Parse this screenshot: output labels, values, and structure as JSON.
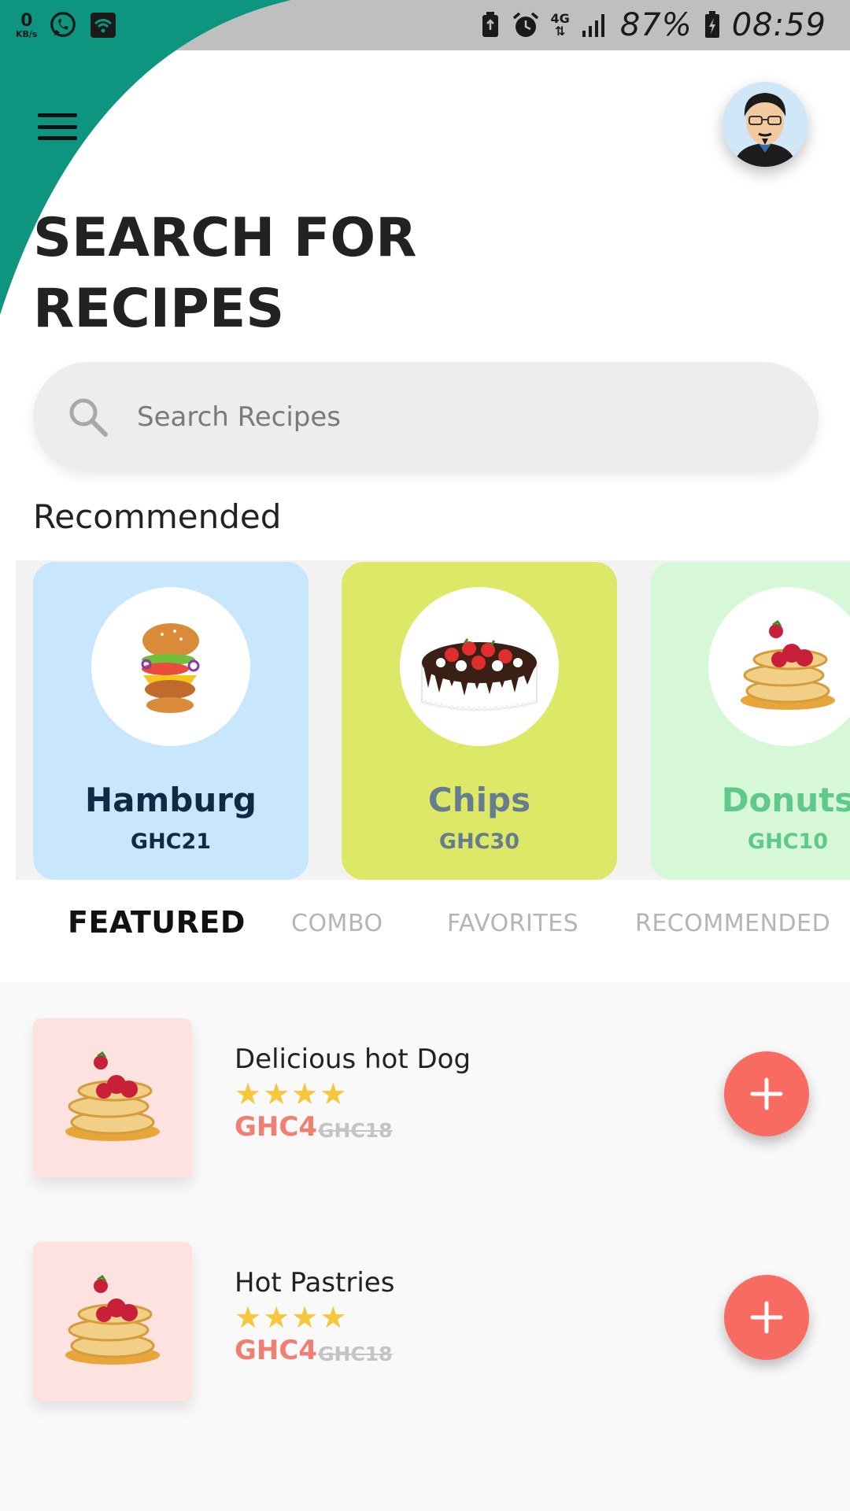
{
  "status_bar": {
    "speed_value": "0",
    "speed_unit": "KB/s",
    "network": "4G",
    "battery": "87%",
    "time": "08:59"
  },
  "header": {
    "title": "SEARCH FOR RECIPES"
  },
  "search": {
    "placeholder": "Search Recipes"
  },
  "recommended": {
    "title": "Recommended",
    "items": [
      {
        "name": "Hamburg",
        "price": "GHC21",
        "bg": "#c8e6fc",
        "text_color": "#102a45"
      },
      {
        "name": "Chips",
        "price": "GHC30",
        "bg": "#dde866",
        "text_color": "#667c8f"
      },
      {
        "name": "Donuts",
        "price": "GHC10",
        "bg": "#d6f8d6",
        "text_color": "#5ec98b"
      }
    ]
  },
  "tabs": [
    {
      "label": "FEATURED",
      "active": true
    },
    {
      "label": "COMBO",
      "active": false
    },
    {
      "label": "FAVORITES",
      "active": false
    },
    {
      "label": "RECOMMENDED",
      "active": false
    }
  ],
  "featured": [
    {
      "name": "Delicious hot Dog",
      "stars": "★★★★",
      "rating": 4,
      "price": "GHC4",
      "old_price": "GHC18"
    },
    {
      "name": "Hot Pastries",
      "stars": "★★★★",
      "rating": 4,
      "price": "GHC4",
      "old_price": "GHC18"
    }
  ],
  "colors": {
    "teal": "#0e9580",
    "accent": "#f86b60",
    "price": "#f07f72",
    "star": "#f6c63b"
  }
}
